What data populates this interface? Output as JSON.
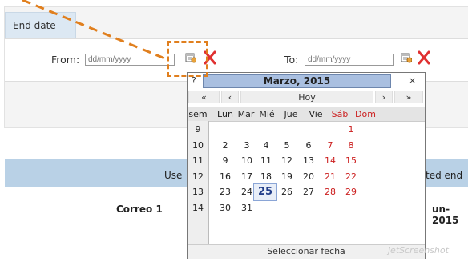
{
  "tab": {
    "label": "End date"
  },
  "from": {
    "label": "From:",
    "placeholder": "dd/mm/yyyy"
  },
  "to": {
    "label": "To:",
    "placeholder": "dd/mm/yyyy"
  },
  "below": {
    "use_text": "Use",
    "ted_end": "ted end",
    "correo": "Correo 1",
    "date_frag": "un-2015"
  },
  "calendar": {
    "help": "?",
    "close": "×",
    "month_title": "Marzo, 2015",
    "nav": {
      "prev_year": "«",
      "prev_month": "‹",
      "today": "Hoy",
      "next_month": "›",
      "next_year": "»"
    },
    "week_header": "sem",
    "day_headers": [
      "Lun",
      "Mar",
      "Mié",
      "Jue",
      "Vie",
      "Sáb",
      "Dom"
    ],
    "weeks": [
      {
        "wk": "9",
        "days": [
          "",
          "",
          "",
          "",
          "",
          "",
          "1"
        ]
      },
      {
        "wk": "10",
        "days": [
          "2",
          "3",
          "4",
          "5",
          "6",
          "7",
          "8"
        ]
      },
      {
        "wk": "11",
        "days": [
          "9",
          "10",
          "11",
          "12",
          "13",
          "14",
          "15"
        ]
      },
      {
        "wk": "12",
        "days": [
          "16",
          "17",
          "18",
          "19",
          "20",
          "21",
          "22"
        ]
      },
      {
        "wk": "13",
        "days": [
          "23",
          "24",
          "25",
          "26",
          "27",
          "28",
          "29"
        ]
      },
      {
        "wk": "14",
        "days": [
          "30",
          "31",
          "",
          "",
          "",
          "",
          ""
        ]
      }
    ],
    "selected_day": "25",
    "footer": "Seleccionar fecha"
  },
  "watermark": "jetScreenshot",
  "colors": {
    "accent_orange": "#e07f1e",
    "weekend_red": "#cc1f1f",
    "band_blue": "#b9d1e6"
  }
}
